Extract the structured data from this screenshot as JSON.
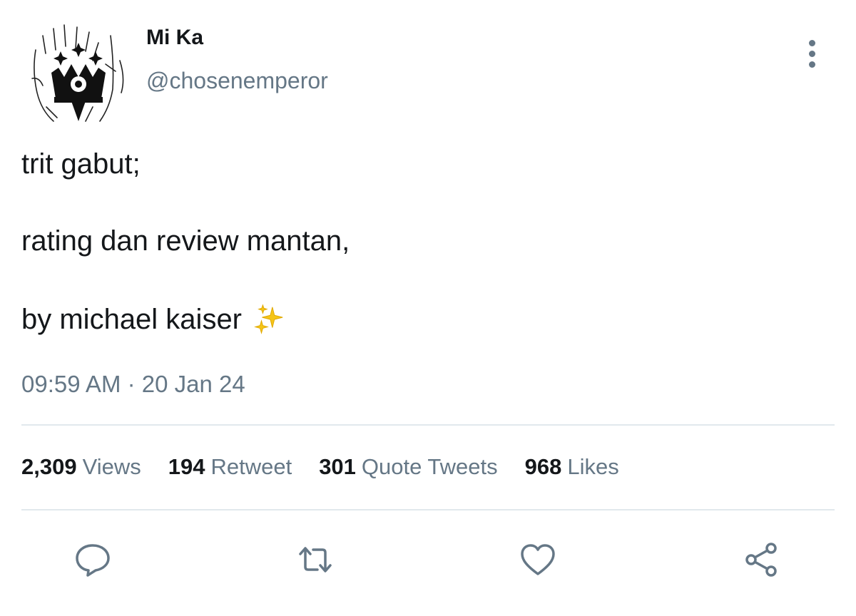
{
  "user": {
    "display_name": "Mi Ka",
    "handle": "@chosenemperor",
    "avatar_icon": "crown-hand-sketch-avatar"
  },
  "tweet": {
    "lines": [
      "trit gabut;",
      "rating dan review mantan,",
      "by michael kaiser"
    ],
    "emoji_icon": "sparkles-icon",
    "timestamp": "09:59 AM · 20 Jan 24"
  },
  "stats": [
    {
      "count": "2,309",
      "label": "Views"
    },
    {
      "count": "194",
      "label": "Retweet"
    },
    {
      "count": "301",
      "label": "Quote Tweets"
    },
    {
      "count": "968",
      "label": "Likes"
    }
  ],
  "actions": [
    "reply-icon",
    "retweet-icon",
    "like-icon",
    "share-icon"
  ],
  "colors": {
    "text": "#14171a",
    "muted": "#657786",
    "divider": "#e1e8ed",
    "sparkle": "#f5c518"
  }
}
